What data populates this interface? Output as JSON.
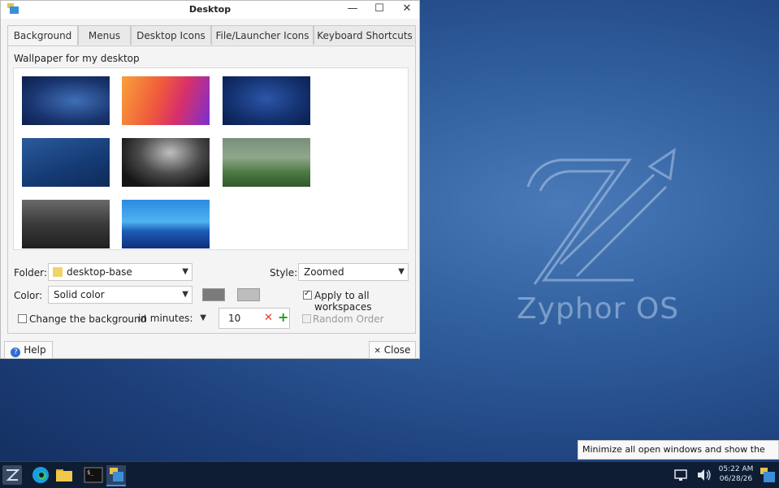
{
  "window": {
    "title": "Desktop",
    "minimize": "—",
    "maximize": "☐",
    "close": "✕"
  },
  "tabs": [
    "Background",
    "Menus",
    "Desktop Icons",
    "File/Launcher Icons",
    "Keyboard Shortcuts"
  ],
  "wallpaper_label": "Wallpaper for my desktop",
  "folder": {
    "label": "Folder:",
    "value": "desktop-base"
  },
  "style": {
    "label": "Style:",
    "value": "Zoomed"
  },
  "color": {
    "label": "Color:",
    "value": "Solid color",
    "swatch1": "#7b7b7b",
    "swatch2": "#bdbdbd"
  },
  "apply_all": "Apply to all workspaces",
  "change_bg": "Change the background",
  "interval": {
    "value": "in minutes:",
    "minutes": "10"
  },
  "random_order": "Random Order",
  "buttons": {
    "help": "Help",
    "close": "Close"
  },
  "desktop_logo_text": "Zyphor OS",
  "tooltip": "Minimize all open windows and show the desktop",
  "clock": {
    "time": "05:22 AM",
    "date": "06/28/26"
  }
}
